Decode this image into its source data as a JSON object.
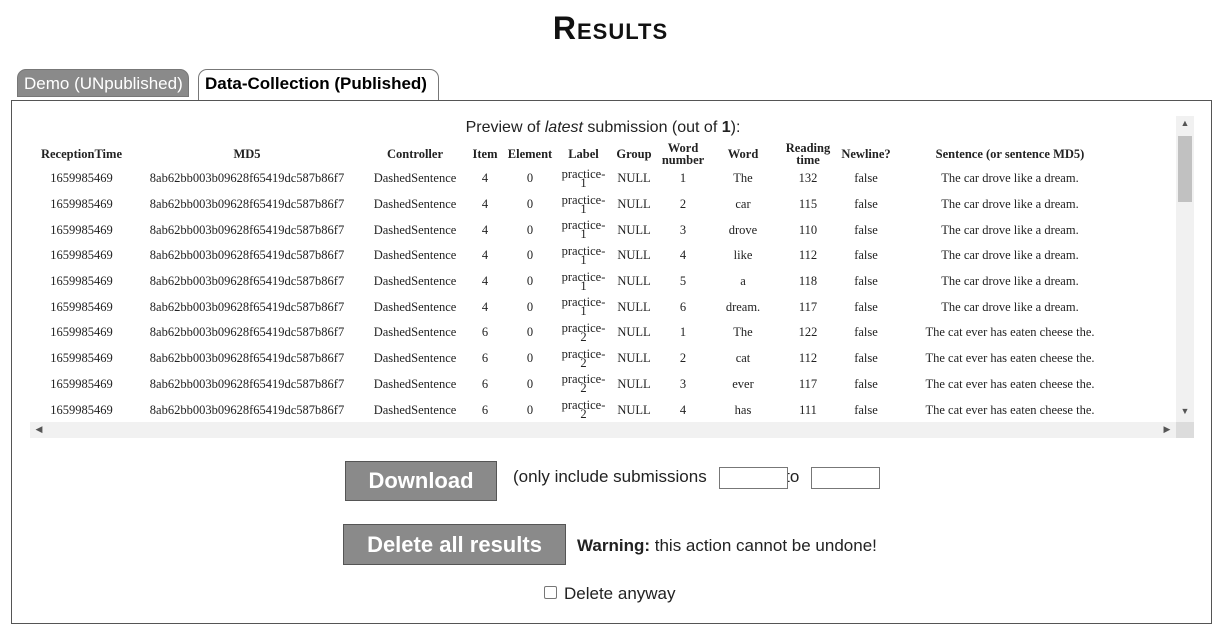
{
  "page": {
    "title": "Results"
  },
  "tabs": [
    {
      "label": "Demo (UNpublished)",
      "active": false
    },
    {
      "label": "Data-Collection (Published)",
      "active": true
    }
  ],
  "preview": {
    "prefix": "Preview of ",
    "emphasis": "latest",
    "middle": " submission (out of ",
    "count": "1",
    "suffix": "):"
  },
  "table": {
    "headers": [
      "ReceptionTime",
      "MD5",
      "Controller",
      "Item",
      "Element",
      "Label",
      "Group",
      "Word number",
      "Word",
      "Reading time",
      "Newline?",
      "Sentence (or sentence MD5)"
    ],
    "rows": [
      [
        "1659985469",
        "8ab62bb003b09628f65419dc587b86f7",
        "DashedSentence",
        "4",
        "0",
        "practice-1",
        "NULL",
        "1",
        "The",
        "132",
        "false",
        "The car drove like a dream."
      ],
      [
        "1659985469",
        "8ab62bb003b09628f65419dc587b86f7",
        "DashedSentence",
        "4",
        "0",
        "practice-1",
        "NULL",
        "2",
        "car",
        "115",
        "false",
        "The car drove like a dream."
      ],
      [
        "1659985469",
        "8ab62bb003b09628f65419dc587b86f7",
        "DashedSentence",
        "4",
        "0",
        "practice-1",
        "NULL",
        "3",
        "drove",
        "110",
        "false",
        "The car drove like a dream."
      ],
      [
        "1659985469",
        "8ab62bb003b09628f65419dc587b86f7",
        "DashedSentence",
        "4",
        "0",
        "practice-1",
        "NULL",
        "4",
        "like",
        "112",
        "false",
        "The car drove like a dream."
      ],
      [
        "1659985469",
        "8ab62bb003b09628f65419dc587b86f7",
        "DashedSentence",
        "4",
        "0",
        "practice-1",
        "NULL",
        "5",
        "a",
        "118",
        "false",
        "The car drove like a dream."
      ],
      [
        "1659985469",
        "8ab62bb003b09628f65419dc587b86f7",
        "DashedSentence",
        "4",
        "0",
        "practice-1",
        "NULL",
        "6",
        "dream.",
        "117",
        "false",
        "The car drove like a dream."
      ],
      [
        "1659985469",
        "8ab62bb003b09628f65419dc587b86f7",
        "DashedSentence",
        "6",
        "0",
        "practice-2",
        "NULL",
        "1",
        "The",
        "122",
        "false",
        "The cat ever has eaten cheese the."
      ],
      [
        "1659985469",
        "8ab62bb003b09628f65419dc587b86f7",
        "DashedSentence",
        "6",
        "0",
        "practice-2",
        "NULL",
        "2",
        "cat",
        "112",
        "false",
        "The cat ever has eaten cheese the."
      ],
      [
        "1659985469",
        "8ab62bb003b09628f65419dc587b86f7",
        "DashedSentence",
        "6",
        "0",
        "practice-2",
        "NULL",
        "3",
        "ever",
        "117",
        "false",
        "The cat ever has eaten cheese the."
      ],
      [
        "1659985469",
        "8ab62bb003b09628f65419dc587b86f7",
        "DashedSentence",
        "6",
        "0",
        "practice-2",
        "NULL",
        "4",
        "has",
        "111",
        "false",
        "The cat ever has eaten cheese the."
      ]
    ]
  },
  "download": {
    "button_label": "Download",
    "range_prefix": "(only include submissions ",
    "range_to": " to ",
    "range_suffix": ")",
    "from_value": "",
    "to_value": ""
  },
  "delete": {
    "button_label": "Delete all results",
    "warning_label": "Warning:",
    "warning_text": " this action cannot be undone!",
    "anyway_label": "Delete anyway",
    "anyway_checked": false
  }
}
